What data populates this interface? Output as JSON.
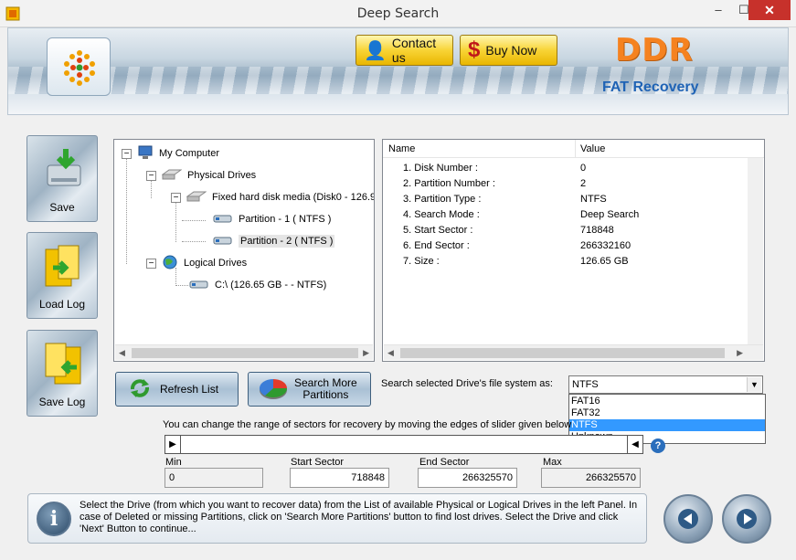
{
  "window": {
    "title": "Deep Search",
    "min": "–",
    "max": "☐",
    "close": "✕"
  },
  "banner": {
    "contact_label": "Contact us",
    "buy_label": "Buy Now",
    "brand": "DDR",
    "product": "FAT Recovery"
  },
  "sidebar": {
    "save": "Save",
    "load_log": "Load Log",
    "save_log": "Save Log"
  },
  "tree": {
    "root": "My Computer",
    "physical": "Physical Drives",
    "disk": "Fixed hard disk media (Disk0 - 126.9",
    "part1": "Partition - 1 ( NTFS )",
    "part2": "Partition - 2 ( NTFS )",
    "logical": "Logical Drives",
    "drive_c": "C:\\ (126.65 GB -  - NTFS)"
  },
  "props": {
    "col_name": "Name",
    "col_value": "Value",
    "rows": [
      {
        "name": "1. Disk Number :",
        "value": "0"
      },
      {
        "name": "2. Partition Number :",
        "value": "2"
      },
      {
        "name": "3. Partition Type :",
        "value": "NTFS"
      },
      {
        "name": "4. Search Mode :",
        "value": "Deep Search"
      },
      {
        "name": "5. Start Sector :",
        "value": "718848"
      },
      {
        "name": "6. End Sector :",
        "value": "266332160"
      },
      {
        "name": "7. Size :",
        "value": "126.65 GB"
      }
    ]
  },
  "actions": {
    "refresh": "Refresh List",
    "more_line1": "Search More",
    "more_line2": "Partitions"
  },
  "fs": {
    "label": "Search selected Drive's file system as:",
    "selected": "NTFS",
    "options": [
      "FAT16",
      "FAT32",
      "NTFS",
      "Unknown"
    ]
  },
  "range": {
    "text": "You can change the range of sectors for recovery by moving the edges of slider given below",
    "min_label": "Min",
    "min": "0",
    "start_label": "Start Sector",
    "start": "718848",
    "end_label": "End Sector",
    "end": "266325570",
    "max_label": "Max",
    "max": "266325570"
  },
  "help": {
    "text": "Select the Drive (from which you want to recover data) from the List of available Physical or Logical Drives in the left Panel. In case of Deleted or missing Partitions, click on 'Search More Partitions' button to find lost drives. Select the Drive and click 'Next' Button to continue..."
  },
  "colors": {
    "accent": "#f58220",
    "brand_blue": "#1f63b5",
    "highlight": "#3399ff",
    "close_red": "#c7312b"
  }
}
